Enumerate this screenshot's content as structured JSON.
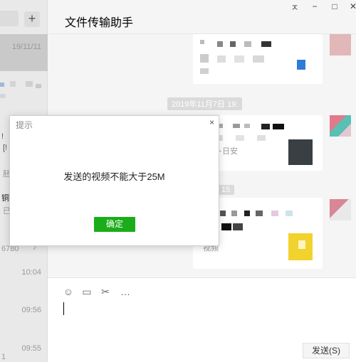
{
  "window": {
    "title": "文件传输助手",
    "controls": {
      "pin": "ㅈ",
      "minimize": "−",
      "maximize": "□",
      "close": "✕"
    }
  },
  "sidebar": {
    "add_label": "+",
    "conversations": [
      {
        "time": "19/11/11"
      },
      {
        "time": "10:04"
      },
      {
        "time": "09:56"
      },
      {
        "time": "09:55"
      }
    ],
    "fragments": [
      "!",
      "[!",
      "胚",
      "铜惠",
      "已秋",
      "6780"
    ]
  },
  "chat": {
    "date_separator": "2019年11月7日 19:",
    "date_separator_2": "15",
    "input_caret": "|",
    "send_label": "发送(S)",
    "toolbar_icons": [
      "emoji-icon",
      "folder-icon",
      "scissors-icon",
      "chat-history-icon"
    ],
    "bubble_fragments": [
      "卜日安",
      "视频"
    ]
  },
  "dialog": {
    "title": "提示",
    "close_symbol": "×",
    "message": "发送的视频不能大于25M",
    "ok_label": "确定",
    "ok_color": "#1aad19"
  }
}
